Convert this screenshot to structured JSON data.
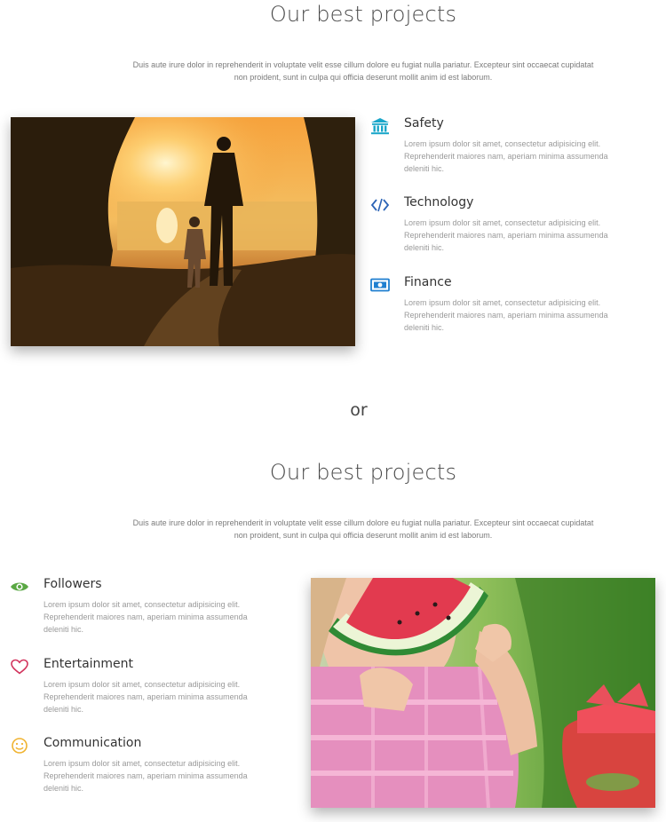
{
  "section_one": {
    "heading": "Our best projects",
    "intro_line1": "Duis aute irure dolor in reprehenderit in voluptate velit esse cillum dolore eu fugiat nulla pariatur. Excepteur sint occaecat cupidatat",
    "intro_line2": "non proident, sunt in culpa qui officia deserunt mollit anim id est laborum.",
    "features": [
      {
        "title": "Safety",
        "icon": "bank-icon",
        "color": "#1aa6c9",
        "desc_line1": "Lorem ipsum dolor sit amet, consectetur adipisicing elit.",
        "desc_line2": "Reprehenderit maiores nam, aperiam minima assumenda",
        "desc_line3": "deleniti hic."
      },
      {
        "title": "Technology",
        "icon": "code-icon",
        "color": "#2b63b5",
        "desc_line1": "Lorem ipsum dolor sit amet, consectetur adipisicing elit.",
        "desc_line2": "Reprehenderit maiores nam, aperiam minima assumenda",
        "desc_line3": "deleniti hic."
      },
      {
        "title": "Finance",
        "icon": "money-icon",
        "color": "#1f7fd0",
        "desc_line1": "Lorem ipsum dolor sit amet, consectetur adipisicing elit.",
        "desc_line2": "Reprehenderit maiores nam, aperiam minima assumenda",
        "desc_line3": "deleniti hic."
      }
    ]
  },
  "separator": "or",
  "section_two": {
    "heading": "Our best projects",
    "intro_line1": "Duis aute irure dolor in reprehenderit in voluptate velit esse cillum dolore eu fugiat nulla pariatur. Excepteur sint occaecat cupidatat",
    "intro_line2": "non proident, sunt in culpa qui officia deserunt mollit anim id est laborum.",
    "features": [
      {
        "title": "Followers",
        "icon": "eye-icon",
        "color": "#5aa844",
        "desc_line1": "Lorem ipsum dolor sit amet, consectetur adipisicing elit.",
        "desc_line2": "Reprehenderit maiores nam, aperiam minima assumenda",
        "desc_line3": "deleniti hic."
      },
      {
        "title": "Entertainment",
        "icon": "heart-icon",
        "color": "#d2335c",
        "desc_line1": "Lorem ipsum dolor sit amet, consectetur adipisicing elit.",
        "desc_line2": "Reprehenderit maiores nam, aperiam minima assumenda",
        "desc_line3": "deleniti hic."
      },
      {
        "title": "Communication",
        "icon": "smile-icon",
        "color": "#f0b330",
        "desc_line1": "Lorem ipsum dolor sit amet, consectetur adipisicing elit.",
        "desc_line2": "Reprehenderit maiores nam, aperiam minima assumenda",
        "desc_line3": "deleniti hic."
      }
    ]
  }
}
